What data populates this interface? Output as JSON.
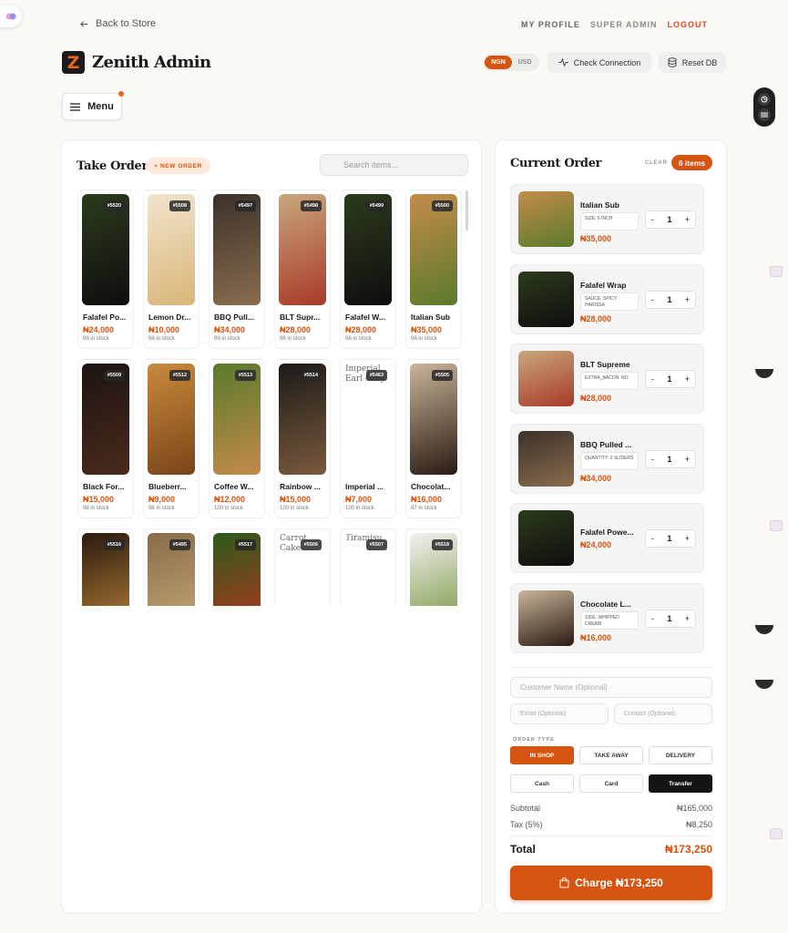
{
  "nav": {
    "back_label": "Back to Store",
    "links": [
      "MY PROFILE",
      "SUPER ADMIN",
      "LOGOUT"
    ]
  },
  "brand": {
    "logo_letter": "Z",
    "name": "Zenith Admin"
  },
  "currency": {
    "options": [
      "NGN",
      "USD"
    ],
    "selected": "NGN"
  },
  "header_buttons": {
    "check": "Check Connection",
    "reset": "Reset DB"
  },
  "menu": {
    "label": "Menu"
  },
  "take_order": {
    "title": "Take Order",
    "new_order": "+ NEW ORDER",
    "search_placeholder": "Search items...",
    "items": [
      {
        "sku": "#5520",
        "name": "Falafel Po...",
        "price": "₦24,000",
        "stock": "99 in stock",
        "c1": "#2c3b1c",
        "c2": "#0e0e0e"
      },
      {
        "sku": "#5508",
        "name": "Lemon Dr...",
        "price": "₦10,000",
        "stock": "98 in stock",
        "c1": "#f1e4cd",
        "c2": "#d9b678"
      },
      {
        "sku": "#5497",
        "name": "BBQ Pull...",
        "price": "₦34,000",
        "stock": "99 in stock",
        "c1": "#3b3129",
        "c2": "#8a6d4e"
      },
      {
        "sku": "#5498",
        "name": "BLT Supr...",
        "price": "₦28,000",
        "stock": "96 in stock",
        "c1": "#c9a77d",
        "c2": "#a83a28"
      },
      {
        "sku": "#5499",
        "name": "Falafel W...",
        "price": "₦28,000",
        "stock": "98 in stock",
        "c1": "#2c3b1c",
        "c2": "#0e0e0e"
      },
      {
        "sku": "#5500",
        "name": "Italian Sub",
        "price": "₦35,000",
        "stock": "98 in stock",
        "c1": "#c48c4a",
        "c2": "#5a7a2c"
      },
      {
        "sku": "#5509",
        "name": "Black For...",
        "price": "₦15,000",
        "stock": "98 in stock",
        "c1": "#1c1411",
        "c2": "#4a2a1c"
      },
      {
        "sku": "#5512",
        "name": "Blueberr...",
        "price": "₦9,000",
        "stock": "98 in stock",
        "c1": "#c98a3c",
        "c2": "#7a4418"
      },
      {
        "sku": "#5513",
        "name": "Coffee W...",
        "price": "₦12,000",
        "stock": "100 in stock",
        "c1": "#5a7a2c",
        "c2": "#c48a4a"
      },
      {
        "sku": "#5514",
        "name": "Rainbow ...",
        "price": "₦15,000",
        "stock": "100 in stock",
        "c1": "#1c1a18",
        "c2": "#7a5a3c"
      },
      {
        "sku": "#5463",
        "name": "Imperial ...",
        "price": "₦7,000",
        "stock": "100 in stock",
        "broken": "Imperial Earl Grey"
      },
      {
        "sku": "#5505",
        "name": "Chocolat...",
        "price": "₦16,000",
        "stock": "97 in stock",
        "c1": "#c9b59a",
        "c2": "#2a1a12"
      },
      {
        "sku": "#5516",
        "name": "",
        "price": "",
        "stock": "",
        "c1": "#2a1a0e",
        "c2": "#c48a3c"
      },
      {
        "sku": "#5495",
        "name": "",
        "price": "",
        "stock": "",
        "c1": "#8a6a4a",
        "c2": "#c9b07a"
      },
      {
        "sku": "#5517",
        "name": "",
        "price": "",
        "stock": "",
        "c1": "#2c5a1c",
        "c2": "#c2321c"
      },
      {
        "sku": "#5506",
        "name": "",
        "price": "",
        "stock": "",
        "broken": "Carrot Cake"
      },
      {
        "sku": "#5507",
        "name": "",
        "price": "",
        "stock": "",
        "broken": "Tiramisu"
      },
      {
        "sku": "#5518",
        "name": "",
        "price": "",
        "stock": "",
        "c1": "#f2f2f0",
        "c2": "#6a8a2c"
      }
    ]
  },
  "current_order": {
    "title": "Current Order",
    "clear": "CLEAR",
    "count": "6 items",
    "items": [
      {
        "name": "Italian Sub",
        "variant": "SIZE: 6 INCH",
        "price": "₦35,000",
        "qty": "1",
        "c1": "#c48c4a",
        "c2": "#5a7a2c"
      },
      {
        "name": "Falafel Wrap",
        "variant": "SAUCE: SPICY HARISSA",
        "price": "₦28,000",
        "qty": "1",
        "c1": "#2c3b1c",
        "c2": "#0e0e0e"
      },
      {
        "name": "BLT Supreme",
        "variant": "EXTRA_BACON: NO",
        "price": "₦28,000",
        "qty": "1",
        "c1": "#c9a77d",
        "c2": "#a83a28"
      },
      {
        "name": "BBQ Pulled ...",
        "variant": "QUANTITY: 2 SLIDERS",
        "price": "₦34,000",
        "qty": "1",
        "c1": "#3b3129",
        "c2": "#8a6d4e"
      },
      {
        "name": "Falafel Powe...",
        "variant": "",
        "price": "₦24,000",
        "qty": "1",
        "c1": "#2c3b1c",
        "c2": "#0e0e0e"
      },
      {
        "name": "Chocolate L...",
        "variant": "SIDE: WHIPPED CREAM",
        "price": "₦16,000",
        "qty": "1",
        "c1": "#c9b59a",
        "c2": "#2a1a12"
      }
    ],
    "customer_placeholder": "Customer Name (Optional)",
    "email_placeholder": "Email (Optional)",
    "contact_placeholder": "Contact (Optional)",
    "order_type_label": "ORDER TYPE",
    "order_types": [
      "IN SHOP",
      "TAKE AWAY",
      "DELIVERY"
    ],
    "selected_order_type": "IN SHOP",
    "payment_methods": [
      "Cash",
      "Card",
      "Transfer"
    ],
    "selected_payment": "Transfer",
    "subtotal_label": "Subtotal",
    "subtotal": "₦165,000",
    "tax_label": "Tax (5%)",
    "tax": "₦8,250",
    "total_label": "Total",
    "total": "₦173,250",
    "charge_label": "Charge ₦173,250"
  },
  "colors": {
    "accent": "#d45410",
    "danger": "#d94a2a",
    "dark": "#141414"
  }
}
